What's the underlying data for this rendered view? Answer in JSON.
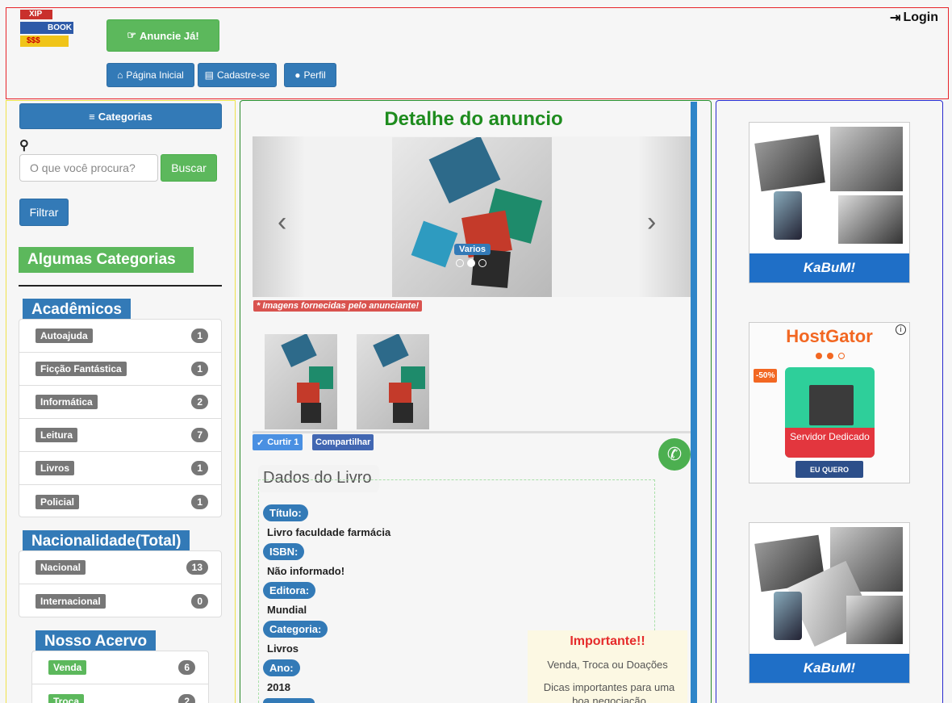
{
  "header": {
    "logo_lines": [
      "XIP",
      "BOOK",
      "$$$"
    ],
    "cta_label": "Anuncie Já!",
    "nav": [
      {
        "label": "Página Inicial"
      },
      {
        "label": "Cadastre-se"
      },
      {
        "label": "Perfil"
      }
    ],
    "login_label": "Login"
  },
  "sidebar": {
    "categories_button": "Categorias",
    "search_placeholder": "O que você procura?",
    "search_button": "Buscar",
    "filter_button": "Filtrar",
    "section_title": "Algumas Categorias",
    "academicos": {
      "title": "Acadêmicos",
      "items": [
        {
          "label": "Autoajuda",
          "count": "1"
        },
        {
          "label": "Ficção Fantástica",
          "count": "1"
        },
        {
          "label": "Informática",
          "count": "2"
        },
        {
          "label": "Leitura",
          "count": "7"
        },
        {
          "label": "Livros",
          "count": "1"
        },
        {
          "label": "Policial",
          "count": "1"
        }
      ]
    },
    "nacionalidade": {
      "title": "Nacionalidade(Total)",
      "items": [
        {
          "label": "Nacional",
          "count": "13"
        },
        {
          "label": "Internacional",
          "count": "0"
        }
      ]
    },
    "acervo": {
      "title": "Nosso Acervo",
      "items": [
        {
          "label": "Venda",
          "count": "6"
        },
        {
          "label": "Troca",
          "count": "2"
        }
      ]
    }
  },
  "main": {
    "title": "Detalhe do anuncio",
    "carousel_caption": "Varios",
    "image_note": "* Imagens fornecidas pelo anunciante!",
    "like_label": "Curtir 1",
    "share_label": "Compartilhar",
    "dados_title": "Dados do Livro",
    "fields": [
      {
        "label": "Título:",
        "value": "Livro faculdade farmácia"
      },
      {
        "label": "ISBN:",
        "value": "Não informado!"
      },
      {
        "label": "Editora:",
        "value": "Mundial"
      },
      {
        "label": "Categoria:",
        "value": "Livros"
      },
      {
        "label": "Ano:",
        "value": "2018"
      }
    ],
    "important": {
      "title": "Importante!!",
      "line1": "Venda, Troca ou Doações",
      "line2": "Dicas importantes para uma boa negociação"
    }
  },
  "ads": {
    "kabum_brand": "KaBuM!",
    "hostgator_brand": "HostGator",
    "hostgator_discount": "-50%",
    "hostgator_product": "Servidor Dedicado",
    "hostgator_cta": "EU QUERO"
  },
  "colors": {
    "primary": "#337ab7",
    "success": "#5cb85c",
    "heading_green": "#1e8c1e",
    "danger": "#d9534f"
  }
}
